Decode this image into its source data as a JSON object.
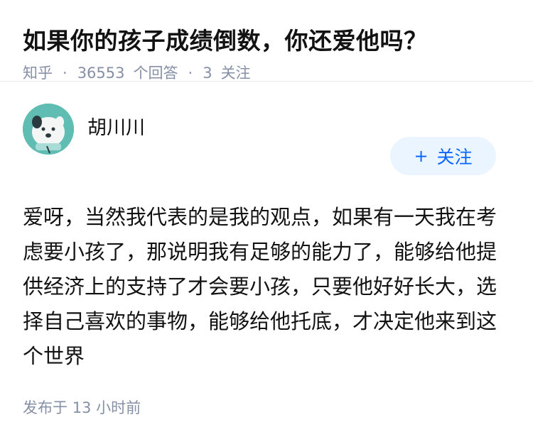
{
  "question": {
    "title": "如果你的孩子成绩倒数，你还爱他吗？",
    "source": "知乎",
    "answer_count": "36553",
    "answer_label": "个回答",
    "follower_count": "3",
    "follower_label": "关注"
  },
  "answer": {
    "author_name": "胡川川",
    "follow_button": {
      "icon": "+",
      "label": "关注"
    },
    "text": "爱呀，当然我代表的是我的观点，如果有一天我在考虑要小孩了，那说明我有足够的能力了，能够给他提供经济上的支持了才会要小孩，只要他好好长大，选择自己喜欢的事物，能够给他托底，才决定他来到这个世界",
    "published_label": "发布于",
    "published_time": "13 小时前"
  },
  "colors": {
    "accent": "#0a66ff",
    "button_bg": "#ebf5ff",
    "meta_gray": "#8590a6",
    "avatar_bg": "#5fbdb4"
  }
}
